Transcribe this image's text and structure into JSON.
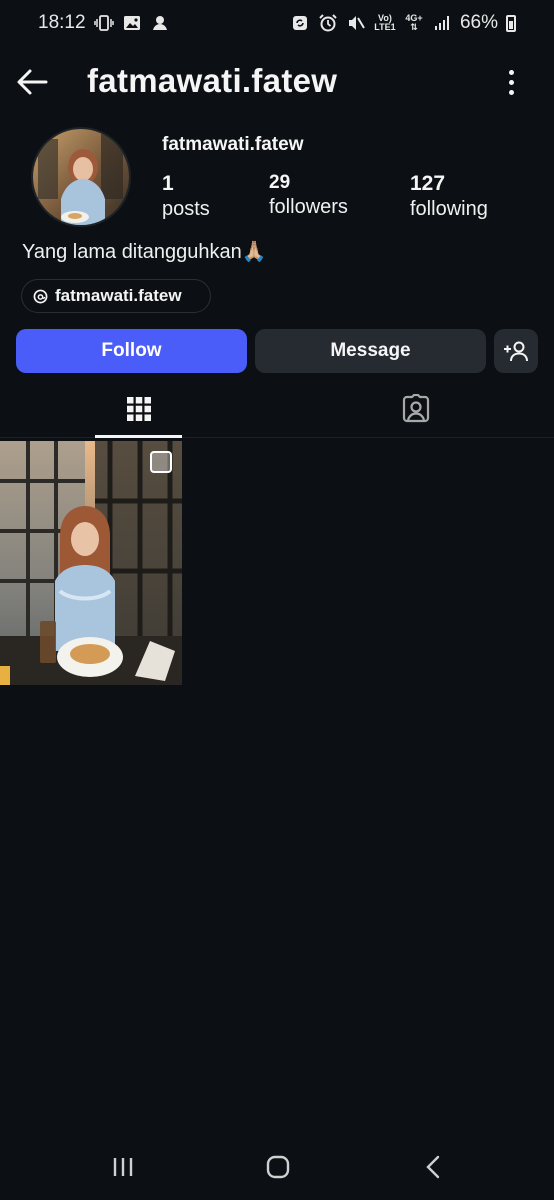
{
  "status_bar": {
    "time": "18:12",
    "network_top": "Vo)",
    "network_bottom": "LTE1",
    "signal_type": "4G+",
    "battery": "66%",
    "icons": [
      "vibrate-icon",
      "gallery-icon",
      "app-notification-icon",
      "sync-icon",
      "alarm-icon",
      "mute-icon",
      "signal-icon",
      "battery-icon"
    ]
  },
  "header": {
    "title": "fatmawati.fatew"
  },
  "profile": {
    "name": "fatmawati.fatew",
    "stats": [
      {
        "value": "1",
        "label": "posts"
      },
      {
        "value": "29",
        "label": "followers"
      },
      {
        "value": "127",
        "label": "following"
      }
    ],
    "bio": "Yang lama ditangguhkan🙏🏼",
    "threads_handle": "fatmawati.fatew"
  },
  "actions": {
    "follow_label": "Follow",
    "message_label": "Message"
  },
  "colors": {
    "background": "#0c1014",
    "follow_button": "#4a5df9",
    "secondary_button": "#262a31"
  },
  "tabs": [
    "grid-icon",
    "tagged-icon"
  ],
  "posts_count_shown": 1
}
